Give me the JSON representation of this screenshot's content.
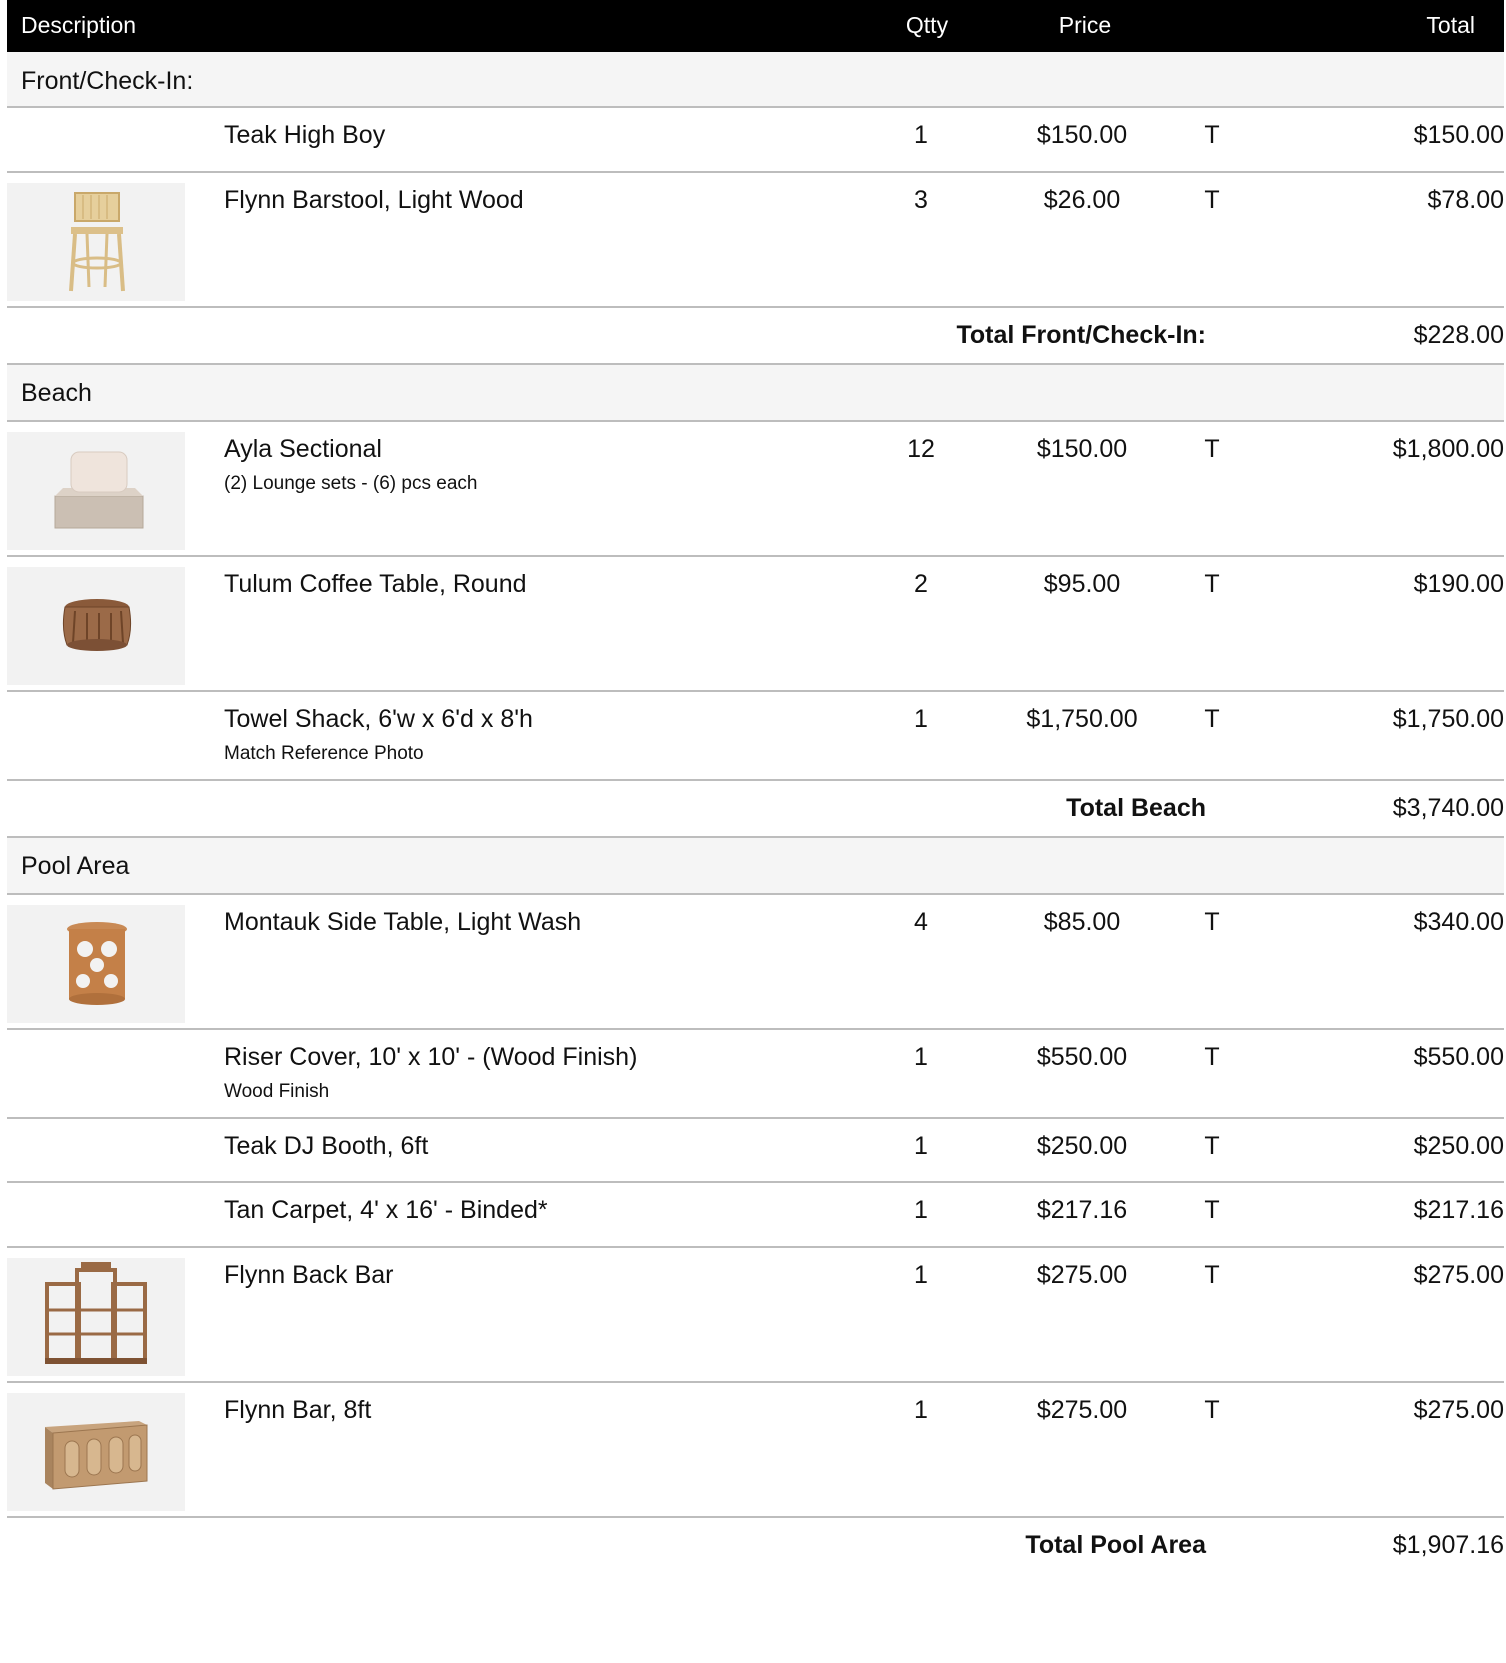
{
  "header": {
    "description": "Description",
    "qty": "Qtty",
    "price": "Price",
    "total": "Total"
  },
  "sections": [
    {
      "title": "Front/Check-In:",
      "items": [
        {
          "name": "Teak High Boy",
          "note": "",
          "qty": "1",
          "price": "$150.00",
          "tax": "T",
          "total": "$150.00",
          "image": null
        },
        {
          "name": "Flynn Barstool, Light Wood",
          "note": "",
          "qty": "3",
          "price": "$26.00",
          "tax": "T",
          "total": "$78.00",
          "image": "barstool"
        }
      ],
      "subtotal_label": "Total Front/Check-In:",
      "subtotal": "$228.00"
    },
    {
      "title": "Beach",
      "items": [
        {
          "name": "Ayla Sectional",
          "note": "(2) Lounge sets - (6) pcs each",
          "qty": "12",
          "price": "$150.00",
          "tax": "T",
          "total": "$1,800.00",
          "image": "sectional"
        },
        {
          "name": "Tulum Coffee Table, Round",
          "note": "",
          "qty": "2",
          "price": "$95.00",
          "tax": "T",
          "total": "$190.00",
          "image": "coffee-table"
        },
        {
          "name": "Towel Shack, 6'w x 6'd x 8'h",
          "note": "Match Reference Photo",
          "qty": "1",
          "price": "$1,750.00",
          "tax": "T",
          "total": "$1,750.00",
          "image": null
        }
      ],
      "subtotal_label": "Total Beach",
      "subtotal": "$3,740.00"
    },
    {
      "title": "Pool Area",
      "items": [
        {
          "name": "Montauk Side Table, Light Wash",
          "note": "",
          "qty": "4",
          "price": "$85.00",
          "tax": "T",
          "total": "$340.00",
          "image": "side-table"
        },
        {
          "name": "Riser Cover, 10' x 10' - (Wood Finish)",
          "note": "Wood Finish",
          "qty": "1",
          "price": "$550.00",
          "tax": "T",
          "total": "$550.00",
          "image": null
        },
        {
          "name": "Teak DJ Booth, 6ft",
          "note": "",
          "qty": "1",
          "price": "$250.00",
          "tax": "T",
          "total": "$250.00",
          "image": null
        },
        {
          "name": "Tan Carpet, 4' x 16' - Binded*",
          "note": "",
          "qty": "1",
          "price": "$217.16",
          "tax": "T",
          "total": "$217.16",
          "image": null
        },
        {
          "name": "Flynn Back Bar",
          "note": "",
          "qty": "1",
          "price": "$275.00",
          "tax": "T",
          "total": "$275.00",
          "image": "back-bar"
        },
        {
          "name": "Flynn Bar, 8ft",
          "note": "",
          "qty": "1",
          "price": "$275.00",
          "tax": "T",
          "total": "$275.00",
          "image": "bar"
        }
      ],
      "subtotal_label": "Total Pool Area",
      "subtotal": "$1,907.16"
    }
  ]
}
